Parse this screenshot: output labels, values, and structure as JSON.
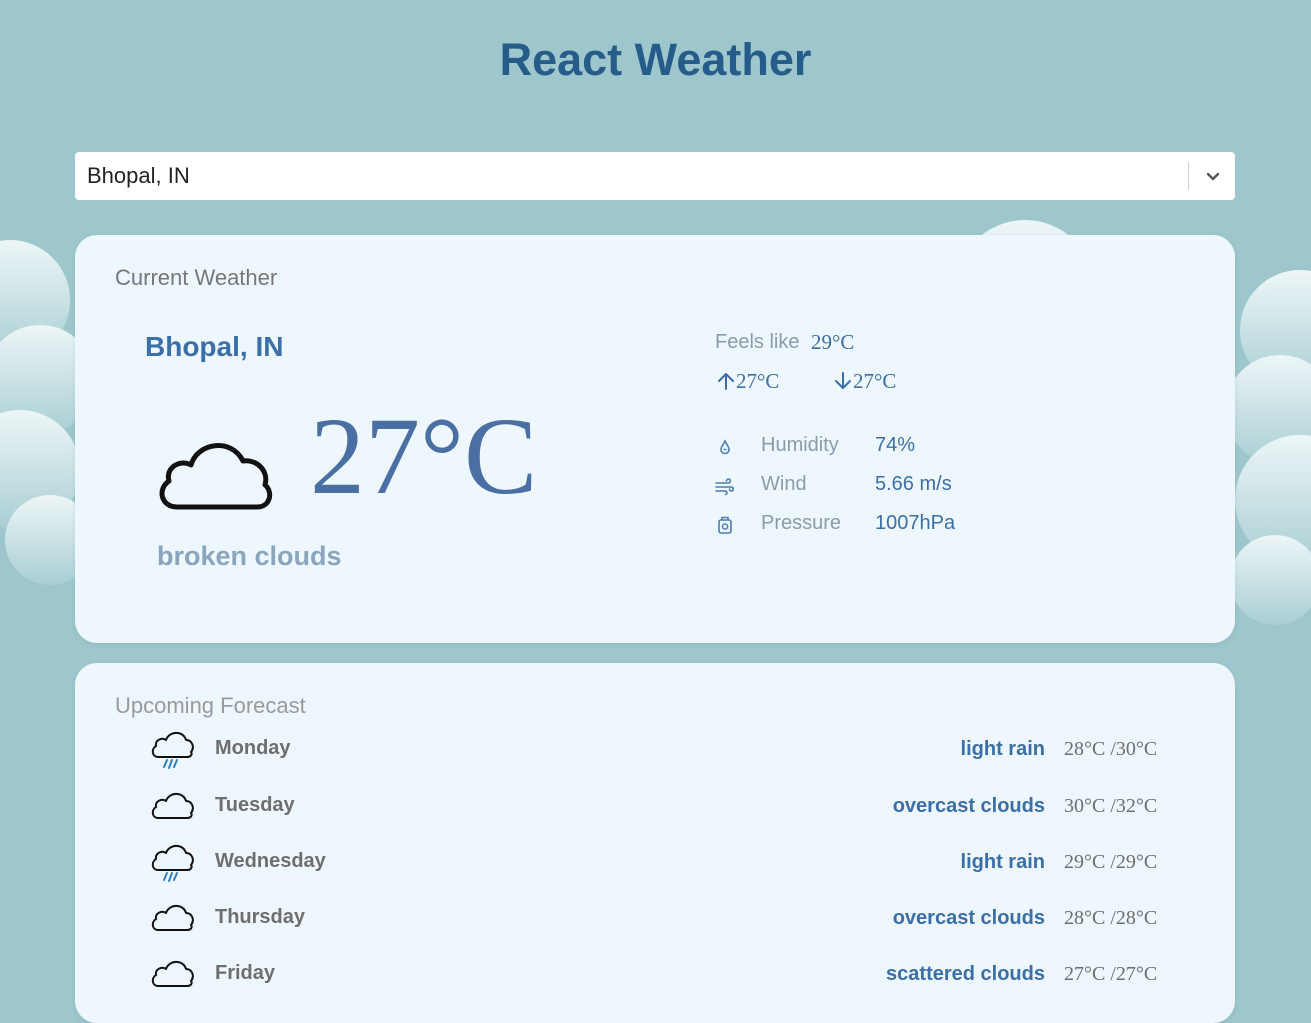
{
  "app": {
    "title": "React Weather"
  },
  "search": {
    "selected_value": "Bhopal, IN",
    "icon": "chevron-down-icon"
  },
  "current": {
    "section_title": "Current Weather",
    "city": "Bhopal, IN",
    "temperature": "27°C",
    "condition_icon": "cloud-icon",
    "description": "broken clouds",
    "feels_like_label": "Feels like",
    "feels_like_value": "29°C",
    "temp_max": "27°C",
    "temp_min": "27°C",
    "details": [
      {
        "icon": "humidity-drop-icon",
        "label": "Humidity",
        "value": "74%"
      },
      {
        "icon": "wind-icon",
        "label": "Wind",
        "value": "5.66 m/s"
      },
      {
        "icon": "pressure-icon",
        "label": "Pressure",
        "value": "1007hPa"
      }
    ]
  },
  "forecast": {
    "section_title": "Upcoming Forecast",
    "days": [
      {
        "day": "Monday",
        "icon": "rain-cloud-icon",
        "description": "light rain",
        "temps": "28°C /30°C"
      },
      {
        "day": "Tuesday",
        "icon": "cloud-icon",
        "description": "overcast clouds",
        "temps": "30°C /32°C"
      },
      {
        "day": "Wednesday",
        "icon": "rain-cloud-icon",
        "description": "light rain",
        "temps": "29°C /29°C"
      },
      {
        "day": "Thursday",
        "icon": "cloud-icon",
        "description": "overcast clouds",
        "temps": "28°C /28°C"
      },
      {
        "day": "Friday",
        "icon": "cloud-icon",
        "description": "scattered clouds",
        "temps": "27°C /27°C"
      }
    ]
  },
  "colors": {
    "background": "#9ec7cd",
    "card": "#eef7fd",
    "title": "#255c8a",
    "accent": "#3b6fa8",
    "muted": "#8a9cac"
  }
}
